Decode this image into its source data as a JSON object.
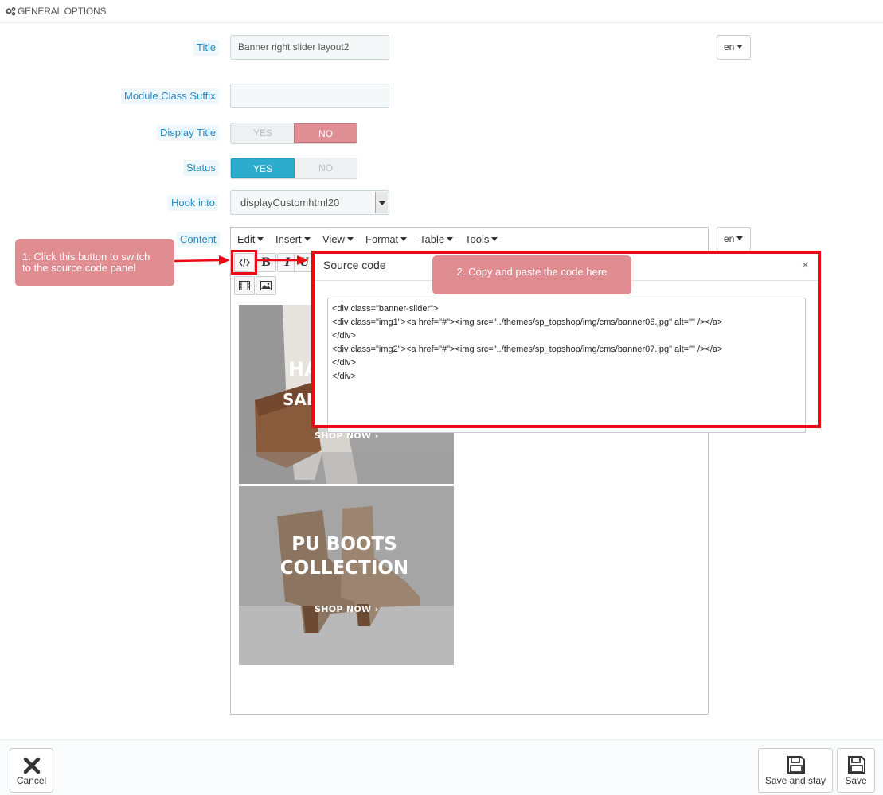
{
  "header": {
    "title": "GENERAL OPTIONS",
    "icon": "cogs-icon"
  },
  "form": {
    "title": {
      "label": "Title",
      "value": "Banner right slider layout2",
      "lang": "en"
    },
    "class_suffix": {
      "label": "Module Class Suffix",
      "value": ""
    },
    "display_title": {
      "label": "Display Title",
      "yes": "YES",
      "no": "NO",
      "selected": "NO"
    },
    "status": {
      "label": "Status",
      "yes": "YES",
      "no": "NO",
      "selected": "YES"
    },
    "hook": {
      "label": "Hook into",
      "value": "displayCustomhtml20"
    },
    "content": {
      "label": "Content",
      "lang": "en"
    }
  },
  "editor": {
    "menu": [
      "Edit",
      "Insert",
      "View",
      "Format",
      "Table",
      "Tools"
    ],
    "toolbar": {
      "bold": "B",
      "italic": "I",
      "underline": "U",
      "source_icon": "code-icon",
      "video_icon": "film-icon",
      "image_icon": "image-icon"
    },
    "banners": [
      {
        "line1": "HA",
        "line2": "SAL",
        "cta": "SHOP NOW"
      },
      {
        "line1": "PU BOOTS",
        "line2": "COLLECTION",
        "cta": "SHOP NOW"
      }
    ]
  },
  "dialog": {
    "title": "Source code",
    "close": "×",
    "code": "<div class=\"banner-slider\">\n<div class=\"img1\"><a href=\"#\"><img src=\"../themes/sp_topshop/img/cms/banner06.jpg\" alt=\"\" /></a>\n</div>\n<div class=\"img2\"><a href=\"#\"><img src=\"../themes/sp_topshop/img/cms/banner07.jpg\" alt=\"\" /></a>\n</div>\n</div>"
  },
  "annotations": {
    "note1": "1. Click this button to switch\nto the source code panel",
    "note2": "2. Copy and paste the code here"
  },
  "footer": {
    "cancel": "Cancel",
    "save_and_stay": "Save and stay",
    "save": "Save"
  },
  "colors": {
    "accent": "#2eacce",
    "no_active": "#e08f95",
    "highlight": "#ea0a16",
    "label_bg": "#eef7fb",
    "label_text": "#2a8bc1"
  }
}
